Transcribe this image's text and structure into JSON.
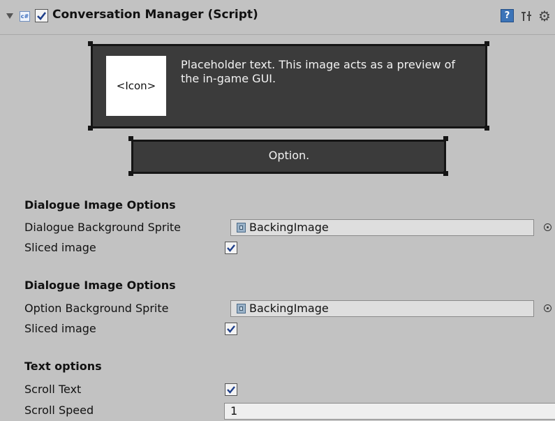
{
  "component": {
    "title": "Conversation Manager (Script)",
    "cs_badge": "c#",
    "enabled": true,
    "help_glyph": "?",
    "gear_glyph": "⚙"
  },
  "preview": {
    "icon_label": "<Icon>",
    "text": "Placeholder text. This image acts as a preview of the in-game GUI.",
    "option_label": "Option."
  },
  "dialogue_image_options": {
    "heading": "Dialogue Image Options",
    "sprite_label": "Dialogue Background Sprite",
    "sprite_value": "BackingImage",
    "sliced_label": "Sliced image",
    "sliced": true
  },
  "option_image_options": {
    "heading": "Dialogue Image Options",
    "sprite_label": "Option Background Sprite",
    "sprite_value": "BackingImage",
    "sliced_label": "Sliced image",
    "sliced": true
  },
  "text_options": {
    "heading": "Text options",
    "scroll_text_label": "Scroll Text",
    "scroll_text": true,
    "scroll_speed_label": "Scroll Speed",
    "scroll_speed": "1"
  },
  "colors": {
    "inspector_bg": "#c2c2c2",
    "panel_bg": "#3b3b3b",
    "panel_border": "#151515",
    "field_bg": "#dedede"
  }
}
